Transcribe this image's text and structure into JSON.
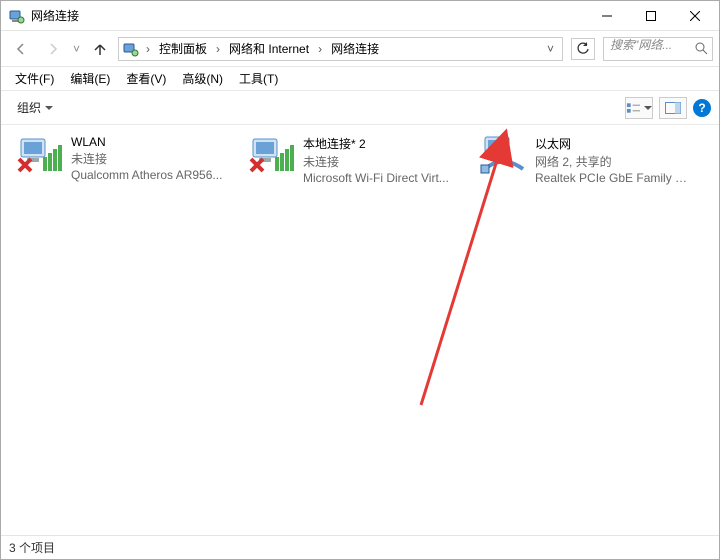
{
  "title": "网络连接",
  "breadcrumb": {
    "root": "控制面板",
    "mid": "网络和 Internet",
    "leaf": "网络连接"
  },
  "search_placeholder": "搜索\"网络...",
  "menus": {
    "file": "文件(F)",
    "edit": "编辑(E)",
    "view": "查看(V)",
    "advanced": "高级(N)",
    "tools": "工具(T)"
  },
  "toolbar": {
    "organize": "组织"
  },
  "connections": [
    {
      "name": "WLAN",
      "status": "未连接",
      "device": "Qualcomm Atheros AR956...",
      "disabled": true
    },
    {
      "name": "本地连接* 2",
      "status": "未连接",
      "device": "Microsoft Wi-Fi Direct Virt...",
      "disabled": true
    },
    {
      "name": "以太网",
      "status": "网络 2, 共享的",
      "device": "Realtek PCIe GbE Family C...",
      "disabled": false
    }
  ],
  "status_text": "3 个项目"
}
